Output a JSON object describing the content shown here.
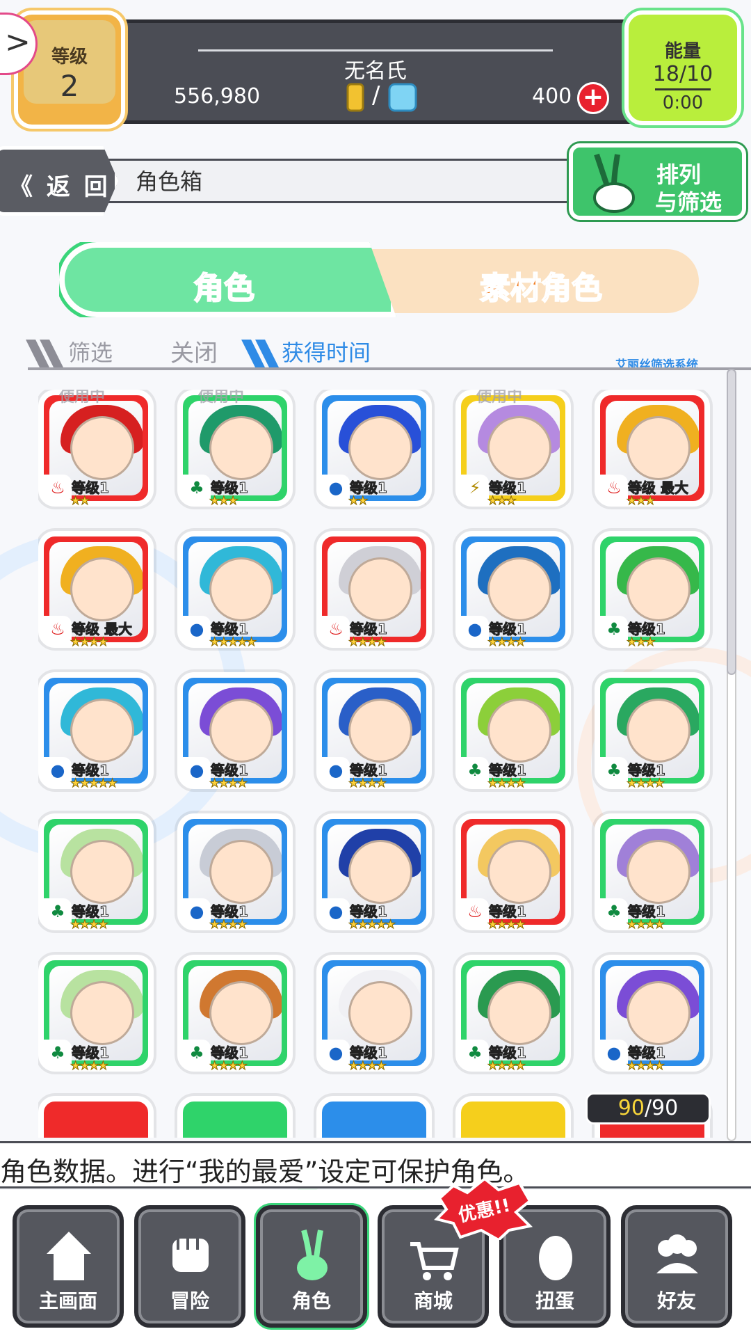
{
  "header": {
    "level_label": "等级",
    "level_value": "2",
    "player_name": "无名氏",
    "gold": "556,980",
    "separator": "/",
    "gems": "400",
    "plus_label": "+",
    "energy_label": "能量",
    "energy_value": "18/10",
    "energy_timer": "0:00",
    "expand_glyph": ">"
  },
  "titlebar": {
    "back_label": "《 返 回",
    "title": "角色箱",
    "sort_line1": "排列",
    "sort_line2": "与筛选"
  },
  "tabs": {
    "characters": "角色",
    "materials": "素材角色"
  },
  "filter": {
    "filter_label": "筛选",
    "filter_state": "关闭",
    "sort_label": "获得时间",
    "system_label": "艾丽丝筛选系统"
  },
  "cards": [
    {
      "element": "fire",
      "level": "等级1",
      "stars": "★★",
      "using": "使用中",
      "hair": "#d62020"
    },
    {
      "element": "wood",
      "level": "等级1",
      "stars": "★★★",
      "using": "使用中",
      "hair": "#1f9a6a"
    },
    {
      "element": "water",
      "level": "等级1",
      "stars": "★★",
      "using": "",
      "hair": "#2850d8"
    },
    {
      "element": "light",
      "level": "等级1",
      "stars": "★★★",
      "using": "使用中",
      "hair": "#b58ae0"
    },
    {
      "element": "fire",
      "level": "等级 最大",
      "stars": "★★★",
      "using": "",
      "hair": "#f0b020"
    },
    {
      "element": "fire",
      "level": "等级 最大",
      "stars": "★★★★",
      "using": "",
      "hair": "#f0b020"
    },
    {
      "element": "water",
      "level": "等级1",
      "stars": "★★★★★",
      "using": "",
      "hair": "#30b8d8"
    },
    {
      "element": "fire",
      "level": "等级1",
      "stars": "★★★★",
      "using": "",
      "hair": "#cfcfd6"
    },
    {
      "element": "water",
      "level": "等级1",
      "stars": "★★★★",
      "using": "",
      "hair": "#1e6fc0"
    },
    {
      "element": "wood",
      "level": "等级1",
      "stars": "★★★",
      "using": "",
      "hair": "#36b84a"
    },
    {
      "element": "water",
      "level": "等级1",
      "stars": "★★★★★",
      "using": "",
      "hair": "#30b8d8"
    },
    {
      "element": "water",
      "level": "等级1",
      "stars": "★★★★",
      "using": "",
      "hair": "#7b4dd6"
    },
    {
      "element": "water",
      "level": "等级1",
      "stars": "★★★★",
      "using": "",
      "hair": "#2a5fc8"
    },
    {
      "element": "wood",
      "level": "等级1",
      "stars": "★★★★",
      "using": "",
      "hair": "#8ccf3a"
    },
    {
      "element": "wood",
      "level": "等级1",
      "stars": "★★★★",
      "using": "",
      "hair": "#2aa860"
    },
    {
      "element": "wood",
      "level": "等级1",
      "stars": "★★★★",
      "using": "",
      "hair": "#b8e2a0"
    },
    {
      "element": "water",
      "level": "等级1",
      "stars": "★★★★",
      "using": "",
      "hair": "#c8ccd6"
    },
    {
      "element": "water",
      "level": "等级1",
      "stars": "★★★★★",
      "using": "",
      "hair": "#2040a8"
    },
    {
      "element": "fire",
      "level": "等级1",
      "stars": "★★★★",
      "using": "",
      "hair": "#f3c860"
    },
    {
      "element": "wood",
      "level": "等级1",
      "stars": "★★★★",
      "using": "",
      "hair": "#a080d8"
    },
    {
      "element": "wood",
      "level": "等级1",
      "stars": "★★★★",
      "using": "",
      "hair": "#b8e2a0"
    },
    {
      "element": "wood",
      "level": "等级1",
      "stars": "★★★★",
      "using": "",
      "hair": "#d07830"
    },
    {
      "element": "water",
      "level": "等级1",
      "stars": "★★★★",
      "using": "",
      "hair": "#f0f0f4"
    },
    {
      "element": "wood",
      "level": "等级1",
      "stars": "★★★★",
      "using": "",
      "hair": "#2a9a50"
    },
    {
      "element": "water",
      "level": "等级1",
      "stars": "★★★★",
      "using": "",
      "hair": "#7b4dd6"
    }
  ],
  "capacity": {
    "current": "90",
    "separator": "/",
    "max": "90"
  },
  "ticker": "角色数据。进行“我的最爱”设定可保护角色。",
  "nav": {
    "home": "主画面",
    "adventure": "冒险",
    "characters": "角色",
    "shop": "商城",
    "gacha": "扭蛋",
    "friends": "好友",
    "shop_badge": "优惠!!"
  },
  "colors": {
    "fire": "#ef2a2a",
    "water": "#2c8eea",
    "wood": "#2fd36a",
    "light": "#f5cf1c",
    "active_green": "#3ad57a",
    "material_orange": "#f07b1e"
  }
}
